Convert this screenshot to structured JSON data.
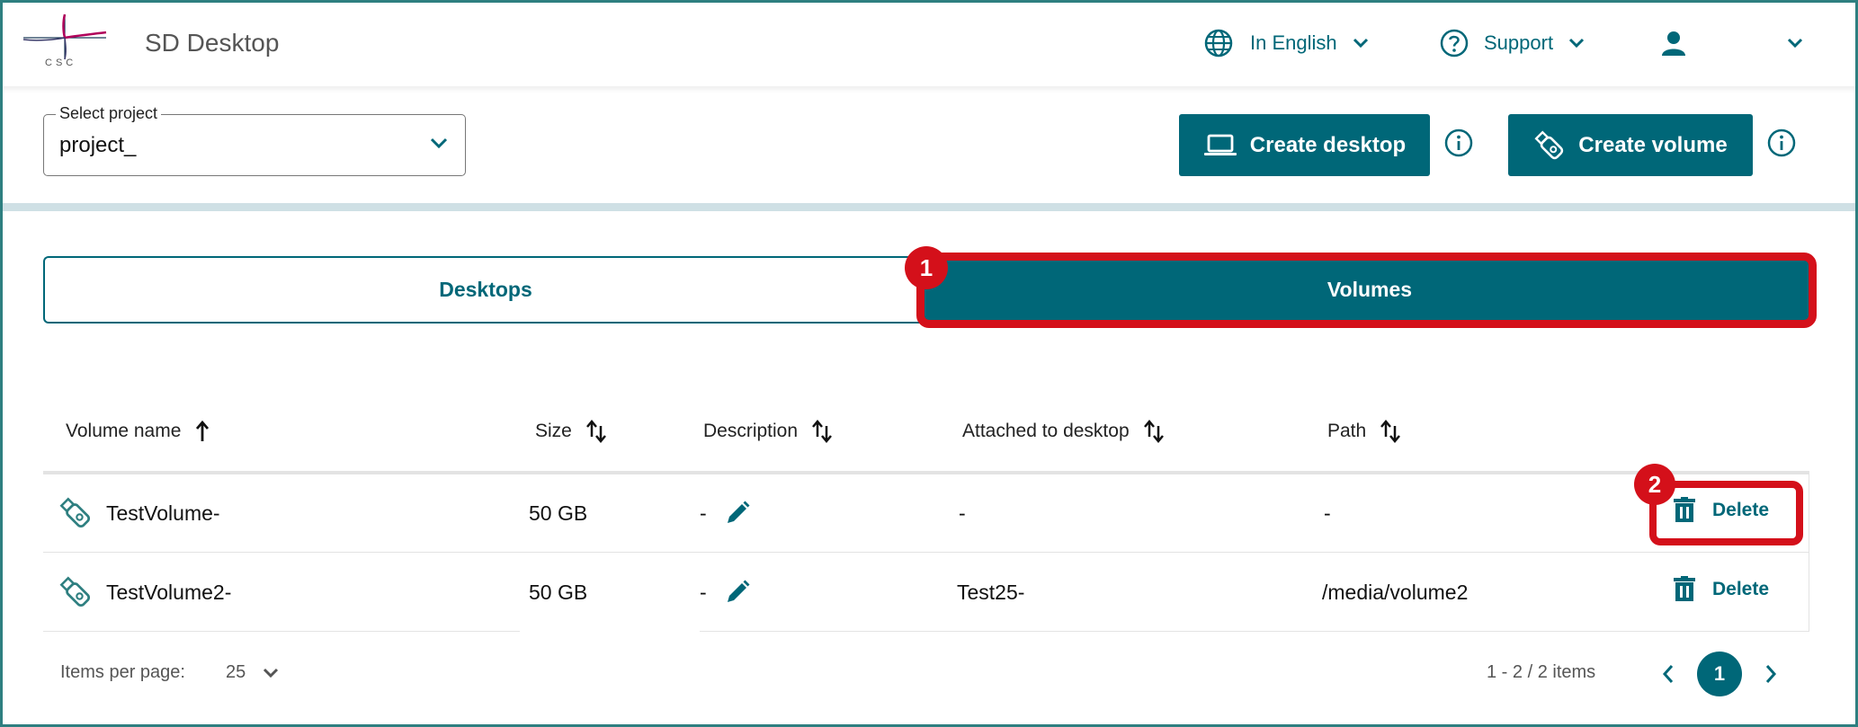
{
  "header": {
    "logo_text": "CSC",
    "app_title": "SD Desktop",
    "language_label": "In English",
    "support_label": "Support"
  },
  "project_select": {
    "legend": "Select project",
    "value": "project_"
  },
  "actions": {
    "create_desktop_label": "Create desktop",
    "create_volume_label": "Create volume"
  },
  "tabs": [
    {
      "label": "Desktops",
      "active": false
    },
    {
      "label": "Volumes",
      "active": true
    }
  ],
  "annotations": {
    "badge_1": "1",
    "badge_2": "2"
  },
  "table": {
    "columns": [
      "Volume name",
      "Size",
      "Description",
      "Attached to desktop",
      "Path"
    ],
    "rows": [
      {
        "name": "TestVolume-",
        "size": "50 GB",
        "description": "-",
        "attached": "-",
        "path": "-",
        "action": "Delete"
      },
      {
        "name": "TestVolume2-",
        "size": "50 GB",
        "description": "-",
        "attached": "Test25-",
        "path": "/media/volume2",
        "action": "Delete"
      }
    ]
  },
  "pagination": {
    "items_per_page_label": "Items per page:",
    "items_per_page_value": "25",
    "range_text": "1 - 2 / 2 items",
    "current_page": "1"
  },
  "colors": {
    "accent": "#006778",
    "highlight": "#d4101a",
    "logo_magenta": "#b0005a"
  }
}
